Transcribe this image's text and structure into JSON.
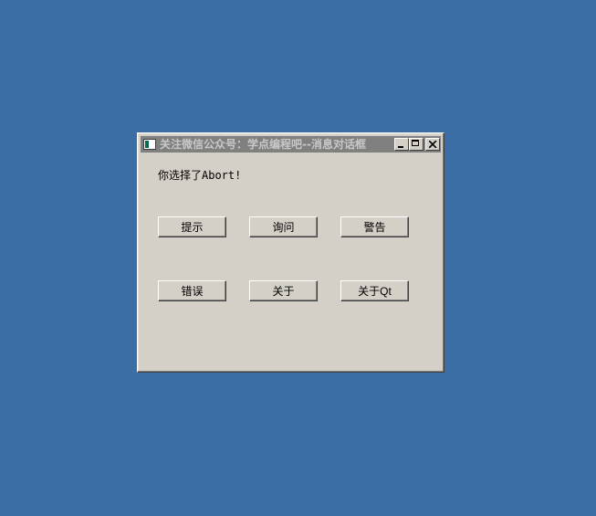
{
  "window": {
    "title": "关注微信公众号：学点编程吧--消息对话框",
    "status_text": "你选择了Abort!"
  },
  "buttons": {
    "info": "提示",
    "question": "询问",
    "warning": "警告",
    "critical": "错误",
    "about": "关于",
    "about_qt": "关于Qt"
  },
  "colors": {
    "desktop": "#3a6ea5",
    "window_bg": "#d4d0c8",
    "titlebar_inactive": "#808080"
  }
}
